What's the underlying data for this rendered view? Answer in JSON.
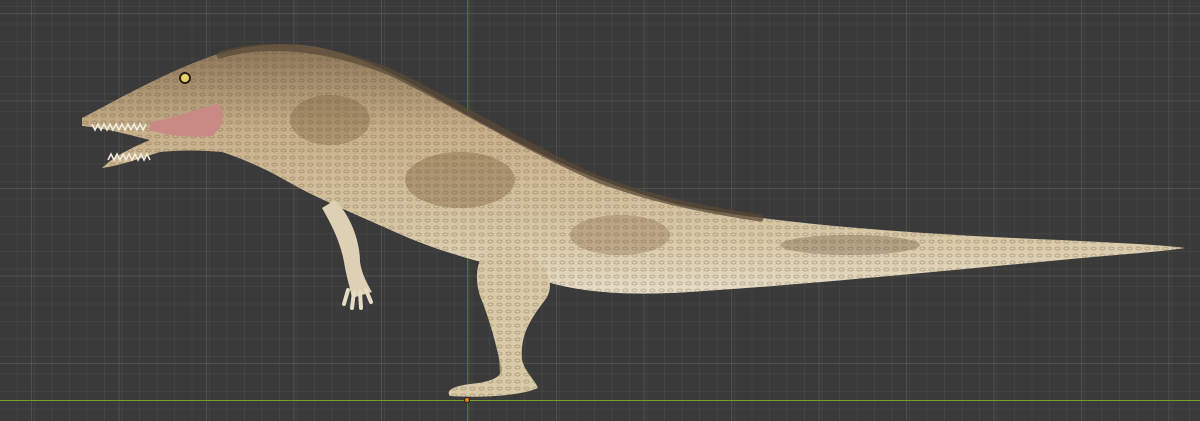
{
  "viewport": {
    "background_color": "#3a3a3a",
    "axis_colors": {
      "vertical": "#3f6bb5",
      "horizontal": "#7a9a2e"
    },
    "origin_color": "#e87d0d"
  },
  "model": {
    "icon": "reptile-model",
    "base_color": "#c8b08a",
    "belly_color": "#e3d7bf",
    "dorsal_color": "#6b5a45"
  }
}
